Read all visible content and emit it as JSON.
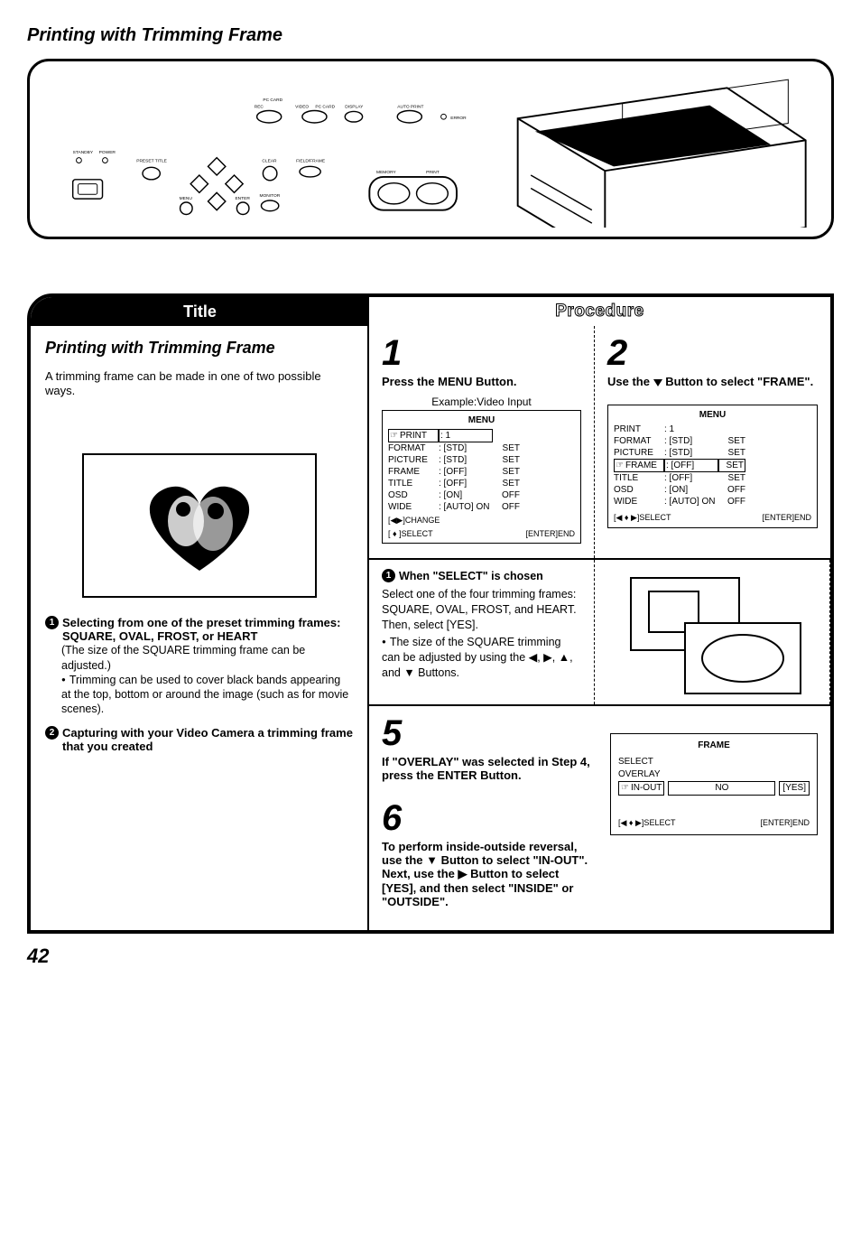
{
  "page_title": "Printing with Trimming Frame",
  "page_number": "42",
  "panel_labels": {
    "standby": "STANDBY",
    "power": "POWER",
    "preset_title": "PRESET TITLE",
    "menu_btn": "MENU",
    "enter_btn": "ENTER",
    "clear": "CLEAR",
    "monitor": "MONITOR",
    "field_frame": "FIELD/FRAME",
    "pc_card": "PC CARD",
    "rec": "REC",
    "video": "VIDEO",
    "pc_card2": "PC CARD",
    "display": "DISPLAY",
    "auto_print": "AUTO PRINT",
    "error": "ERROR",
    "memory": "MEMORY",
    "print_lbl": "PRINT"
  },
  "headers": {
    "title": "Title",
    "procedure": "Procedure"
  },
  "left": {
    "subtitle": "Printing with Trimming Frame",
    "intro": "A trimming frame can be made in one of two possible ways.",
    "opt1_title": "Selecting from one of the preset trimming frames: SQUARE, OVAL, FROST, or HEART",
    "opt1_note": "(The size of the SQUARE trimming frame can be adjusted.)",
    "opt1_bullet": "Trimming can be used to cover black bands appearing at the top, bottom or around the image (such as for movie scenes).",
    "opt2_title": "Capturing with your Video Camera a trimming frame that you created"
  },
  "step1": {
    "num": "1",
    "title": "Press the MENU Button.",
    "example_caption": "Example:Video Input",
    "menu_header": "MENU",
    "rows": [
      {
        "k": "PRINT",
        "v": ": 1",
        "s": ""
      },
      {
        "k": "FORMAT",
        "v": ": [STD]",
        "s": "SET"
      },
      {
        "k": "PICTURE",
        "v": ": [STD]",
        "s": "SET"
      },
      {
        "k": "FRAME",
        "v": ": [OFF]",
        "s": "SET"
      },
      {
        "k": "TITLE",
        "v": ": [OFF]",
        "s": "SET"
      },
      {
        "k": "OSD",
        "v": ": [ON]",
        "s": "OFF"
      },
      {
        "k": "WIDE",
        "v": ": [AUTO]  ON",
        "s": "OFF"
      }
    ],
    "footer_l": "[◀▶]CHANGE",
    "footer_l2": "[ ♦ ]SELECT",
    "footer_r": "[ENTER]END"
  },
  "step2": {
    "num": "2",
    "title_pre": "Use the ",
    "title_post": " Button to select \"FRAME\".",
    "menu_header": "MENU",
    "rows": [
      {
        "k": "PRINT",
        "v": ": 1",
        "s": ""
      },
      {
        "k": "FORMAT",
        "v": ": [STD]",
        "s": "SET"
      },
      {
        "k": "PICTURE",
        "v": ": [STD]",
        "s": "SET"
      },
      {
        "k": "FRAME",
        "v": ": [OFF]",
        "s": "SET",
        "hl": true
      },
      {
        "k": "TITLE",
        "v": ": [OFF]",
        "s": "SET"
      },
      {
        "k": "OSD",
        "v": ": [ON]",
        "s": "OFF"
      },
      {
        "k": "WIDE",
        "v": ": [AUTO]  ON",
        "s": "OFF"
      }
    ],
    "footer_l": "[◀ ♦ ▶]SELECT",
    "footer_r": "[ENTER]END"
  },
  "mid": {
    "heading": "When \"SELECT\" is chosen",
    "body1": "Select one of the four trimming frames: SQUARE, OVAL, FROST, and HEART.",
    "body2": "Then, select [YES].",
    "bullet": "The size of the SQUARE trimming can be adjusted by using the ◀, ▶, ▲, and ▼ Buttons."
  },
  "step5": {
    "num": "5",
    "title": "If \"OVERLAY\" was selected in Step 4, press the ENTER Button."
  },
  "step6": {
    "num": "6",
    "title": "To perform inside-outside reversal, use the ▼ Button to select \"IN-OUT\". Next, use the ▶ Button to select [YES], and then select \"INSIDE\" or \"OUTSIDE\"."
  },
  "frame_box": {
    "header": "FRAME",
    "r1": "SELECT",
    "r2": "OVERLAY",
    "r3_label": "IN-OUT",
    "r3_no": "NO",
    "r3_yes": "[YES]",
    "footer_l": "[◀ ♦ ▶]SELECT",
    "footer_r": "[ENTER]END"
  }
}
